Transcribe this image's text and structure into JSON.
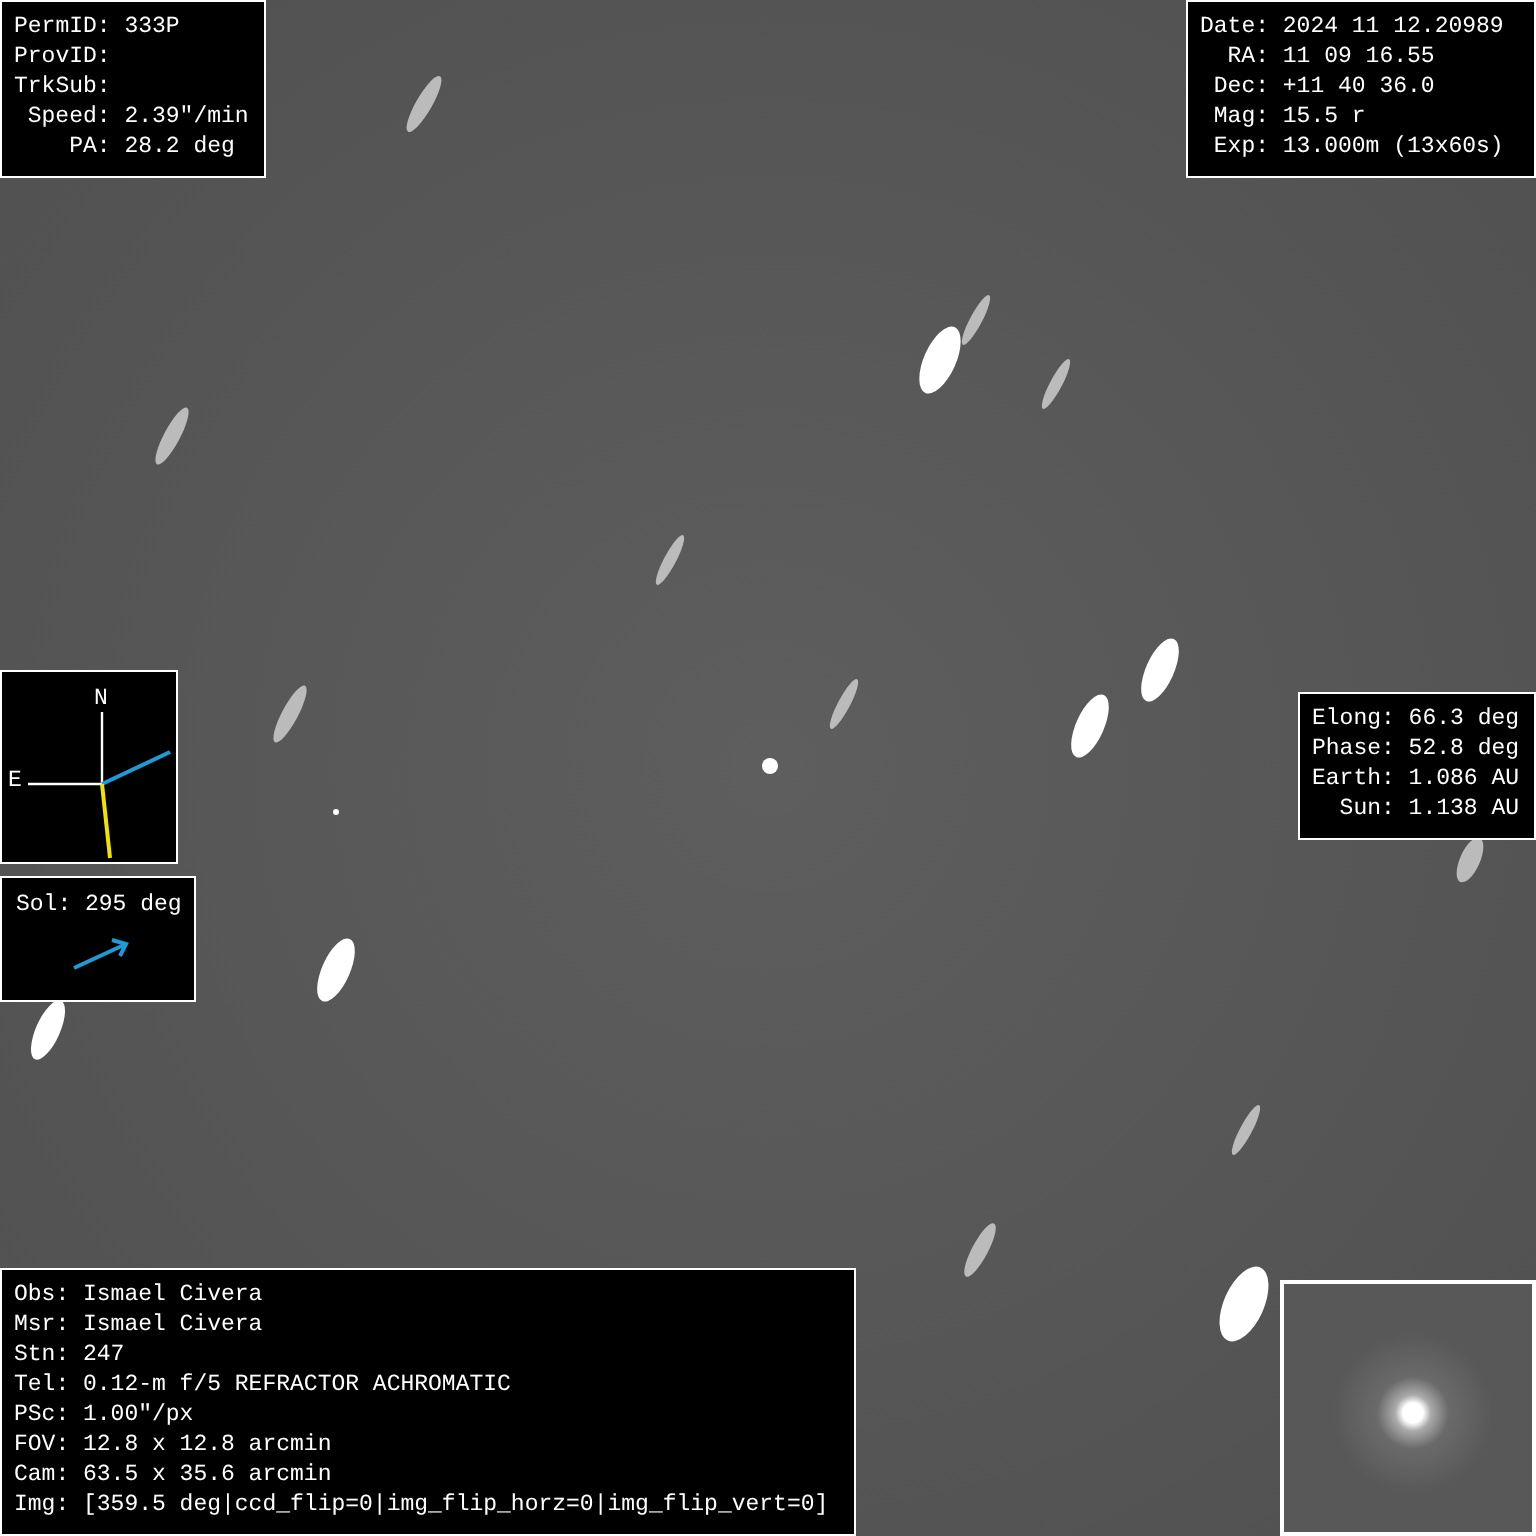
{
  "object_info": [
    {
      "label": "PermID:",
      "value": "333P"
    },
    {
      "label": "ProvID:"
    },
    {
      "label": "TrkSub:"
    },
    {
      "label": "Speed:",
      "value": "2.39\"/min"
    },
    {
      "label": "PA:",
      "value": "28.2 deg"
    }
  ],
  "observation": [
    {
      "label": "Date:",
      "value": "2024 11 12.20989"
    },
    {
      "label": "RA:",
      "value": "11 09 16.55"
    },
    {
      "label": "Dec:",
      "value": "+11 40 36.0"
    },
    {
      "label": "Mag:",
      "value": "15.5 r"
    },
    {
      "label": "Exp:",
      "value": "13.000m (13x60s)"
    }
  ],
  "compass": {
    "north": "N",
    "east": "E"
  },
  "sol": {
    "label": "Sol:",
    "value": "295 deg"
  },
  "geometry": [
    {
      "label": "Elong:",
      "value": "66.3 deg"
    },
    {
      "label": "Phase:",
      "value": "52.8 deg"
    },
    {
      "label": "Earth:",
      "value": "1.086 AU"
    },
    {
      "label": "Sun:",
      "value": "1.138 AU"
    }
  ],
  "details": [
    {
      "label": "Obs:",
      "value": "Ismael Civera"
    },
    {
      "label": "Msr:",
      "value": "Ismael Civera"
    },
    {
      "label": "Stn:",
      "value": "247"
    },
    {
      "label": "Tel:",
      "value": "0.12-m f/5 REFRACTOR ACHROMATIC"
    },
    {
      "label": "PSc:",
      "value": "1.00\"/px"
    },
    {
      "label": "FOV:",
      "value": "12.8 x 12.8 arcmin"
    },
    {
      "label": "Cam:",
      "value": "63.5 x 35.6 arcmin"
    },
    {
      "label": "Img:",
      "value": "[359.5 deg|ccd_flip=0|img_flip_horz=0|img_flip_vert=0]"
    }
  ]
}
